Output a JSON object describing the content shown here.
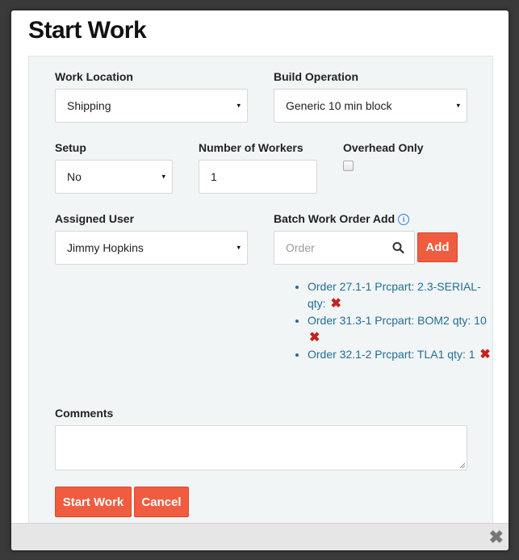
{
  "dialog": {
    "title": "Start Work",
    "work_location": {
      "label": "Work Location",
      "value": "Shipping"
    },
    "build_operation": {
      "label": "Build Operation",
      "value": "Generic 10 min block"
    },
    "setup": {
      "label": "Setup",
      "value": "No"
    },
    "num_workers": {
      "label": "Number of Workers",
      "value": "1"
    },
    "overhead_only": {
      "label": "Overhead Only",
      "checked": false
    },
    "assigned_user": {
      "label": "Assigned User",
      "value": "Jimmy Hopkins"
    },
    "batch": {
      "label": "Batch Work Order Add",
      "info_icon": "info-circle-icon",
      "placeholder": "Order",
      "search_icon": "search-icon",
      "add_label": "Add",
      "orders": [
        {
          "text": "Order 27.1-1 Prcpart: 2.3-SERIAL- qty:"
        },
        {
          "text": "Order 31.3-1 Prcpart: BOM2 qty: 10"
        },
        {
          "text": "Order 32.1-2 Prcpart: TLA1 qty: 1"
        }
      ],
      "remove_icon": "✖"
    },
    "comments": {
      "label": "Comments",
      "value": ""
    },
    "start_work_label": "Start Work",
    "cancel_label": "Cancel",
    "close_icon": "✖",
    "caret": "▾",
    "info_glyph": "i",
    "accent_color": "#f05c40",
    "link_color": "#1f6f93"
  }
}
